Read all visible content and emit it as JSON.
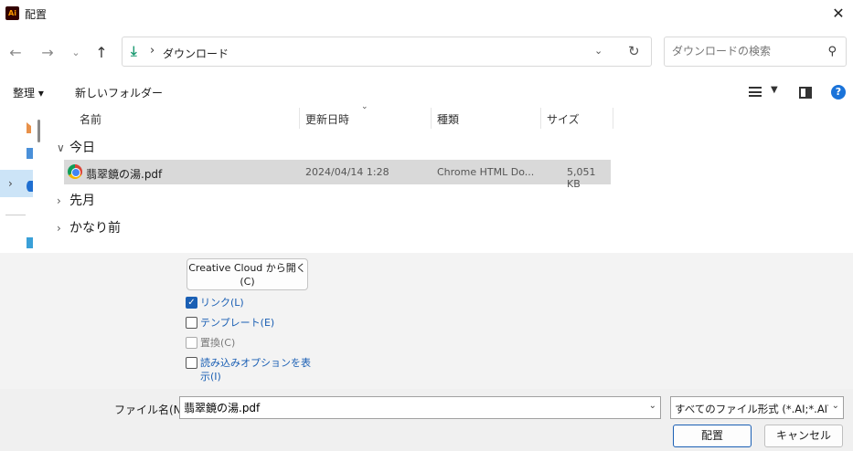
{
  "window": {
    "title": "配置",
    "app_icon": "Ai"
  },
  "nav": {
    "back_icon": "arrow-left-icon",
    "forward_icon": "arrow-right-icon",
    "up_icon": "arrow-up-icon",
    "breadcrumb": "ダウンロード",
    "search_placeholder": "ダウンロードの検索"
  },
  "commands": {
    "organize": "整理 ▾",
    "new_folder": "新しいフォルダー"
  },
  "columns": {
    "name": "名前",
    "modified": "更新日時",
    "type": "種類",
    "size": "サイズ"
  },
  "groups": {
    "today": "今日",
    "last_month": "先月",
    "long_ago": "かなり前"
  },
  "file": {
    "name": "翡翠鏡の湯.pdf",
    "modified": "2024/04/14 1:28",
    "type": "Chrome HTML Do...",
    "size": "5,051 KB"
  },
  "options": {
    "cc_button_line1": "Creative Cloud から開く",
    "cc_button_line2": "(C)",
    "link": {
      "label": "リンク(L)",
      "checked": true
    },
    "template": {
      "label": "テンプレート(E)",
      "checked": false
    },
    "replace": {
      "label": "置換(C)",
      "checked": false,
      "disabled": true
    },
    "import_options": {
      "label_line1": "読み込みオプションを表",
      "label_line2": "示(I)",
      "checked": false
    }
  },
  "footer": {
    "filename_label": "ファイル名(N):",
    "filename_value": "翡翠鏡の湯.pdf",
    "filetype_value": "すべてのファイル形式 (*.AI;*.AIT;*.P",
    "place_button": "配置",
    "cancel_button": "キャンセル"
  },
  "colors": {
    "accent": "#1a5fb4",
    "selection": "#d9d9d9",
    "download_green": "#1e9b73"
  }
}
